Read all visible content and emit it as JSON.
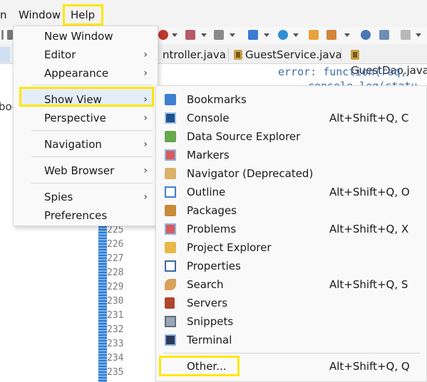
{
  "menubar": {
    "items": [
      {
        "label": "n"
      },
      {
        "label": "Window"
      },
      {
        "label": "Help"
      }
    ]
  },
  "tabs": [
    {
      "label": "ntroller.java"
    },
    {
      "label": "GuestService.java"
    },
    {
      "label": "GuestDao.java"
    }
  ],
  "code": {
    "line1": "error: function(req,",
    "line2": "console.log(statu",
    "left_fragment": "boo"
  },
  "line_numbers": [
    "225",
    "226",
    "227",
    "228",
    "229",
    "230",
    "231",
    "232",
    "233",
    "234",
    "235"
  ],
  "window_menu": {
    "items": [
      {
        "label": "New Window",
        "submenu": false
      },
      {
        "label": "Editor",
        "submenu": true
      },
      {
        "label": "Appearance",
        "submenu": true
      },
      {
        "label": "Show View",
        "submenu": true
      },
      {
        "label": "Perspective",
        "submenu": true
      },
      {
        "label": "Navigation",
        "submenu": true
      },
      {
        "label": "Web Browser",
        "submenu": true
      },
      {
        "label": "Spies",
        "submenu": true
      },
      {
        "label": "Preferences",
        "submenu": false
      }
    ],
    "chevron": "›"
  },
  "show_view_menu": {
    "items": [
      {
        "label": "Bookmarks",
        "accel": "",
        "icon": "bookmarks-icon"
      },
      {
        "label": "Console",
        "accel": "Alt+Shift+Q, C",
        "icon": "console-icon"
      },
      {
        "label": "Data Source Explorer",
        "accel": "",
        "icon": "data-source-explorer-icon"
      },
      {
        "label": "Markers",
        "accel": "",
        "icon": "markers-icon"
      },
      {
        "label": "Navigator (Deprecated)",
        "accel": "",
        "icon": "navigator-icon"
      },
      {
        "label": "Outline",
        "accel": "Alt+Shift+Q, O",
        "icon": "outline-icon"
      },
      {
        "label": "Packages",
        "accel": "",
        "icon": "packages-icon"
      },
      {
        "label": "Problems",
        "accel": "Alt+Shift+Q, X",
        "icon": "problems-icon"
      },
      {
        "label": "Project Explorer",
        "accel": "",
        "icon": "project-explorer-icon"
      },
      {
        "label": "Properties",
        "accel": "",
        "icon": "properties-icon"
      },
      {
        "label": "Search",
        "accel": "Alt+Shift+Q, S",
        "icon": "search-icon"
      },
      {
        "label": "Servers",
        "accel": "",
        "icon": "servers-icon"
      },
      {
        "label": "Snippets",
        "accel": "",
        "icon": "snippets-icon"
      },
      {
        "label": "Terminal",
        "accel": "",
        "icon": "terminal-icon"
      }
    ],
    "other": {
      "label": "Other...",
      "accel": "Alt+Shift+Q, Q"
    }
  },
  "colors": {
    "highlight": "#ffe600",
    "selected_row": "#e4eef9",
    "code_text": "#3b6fb2"
  }
}
